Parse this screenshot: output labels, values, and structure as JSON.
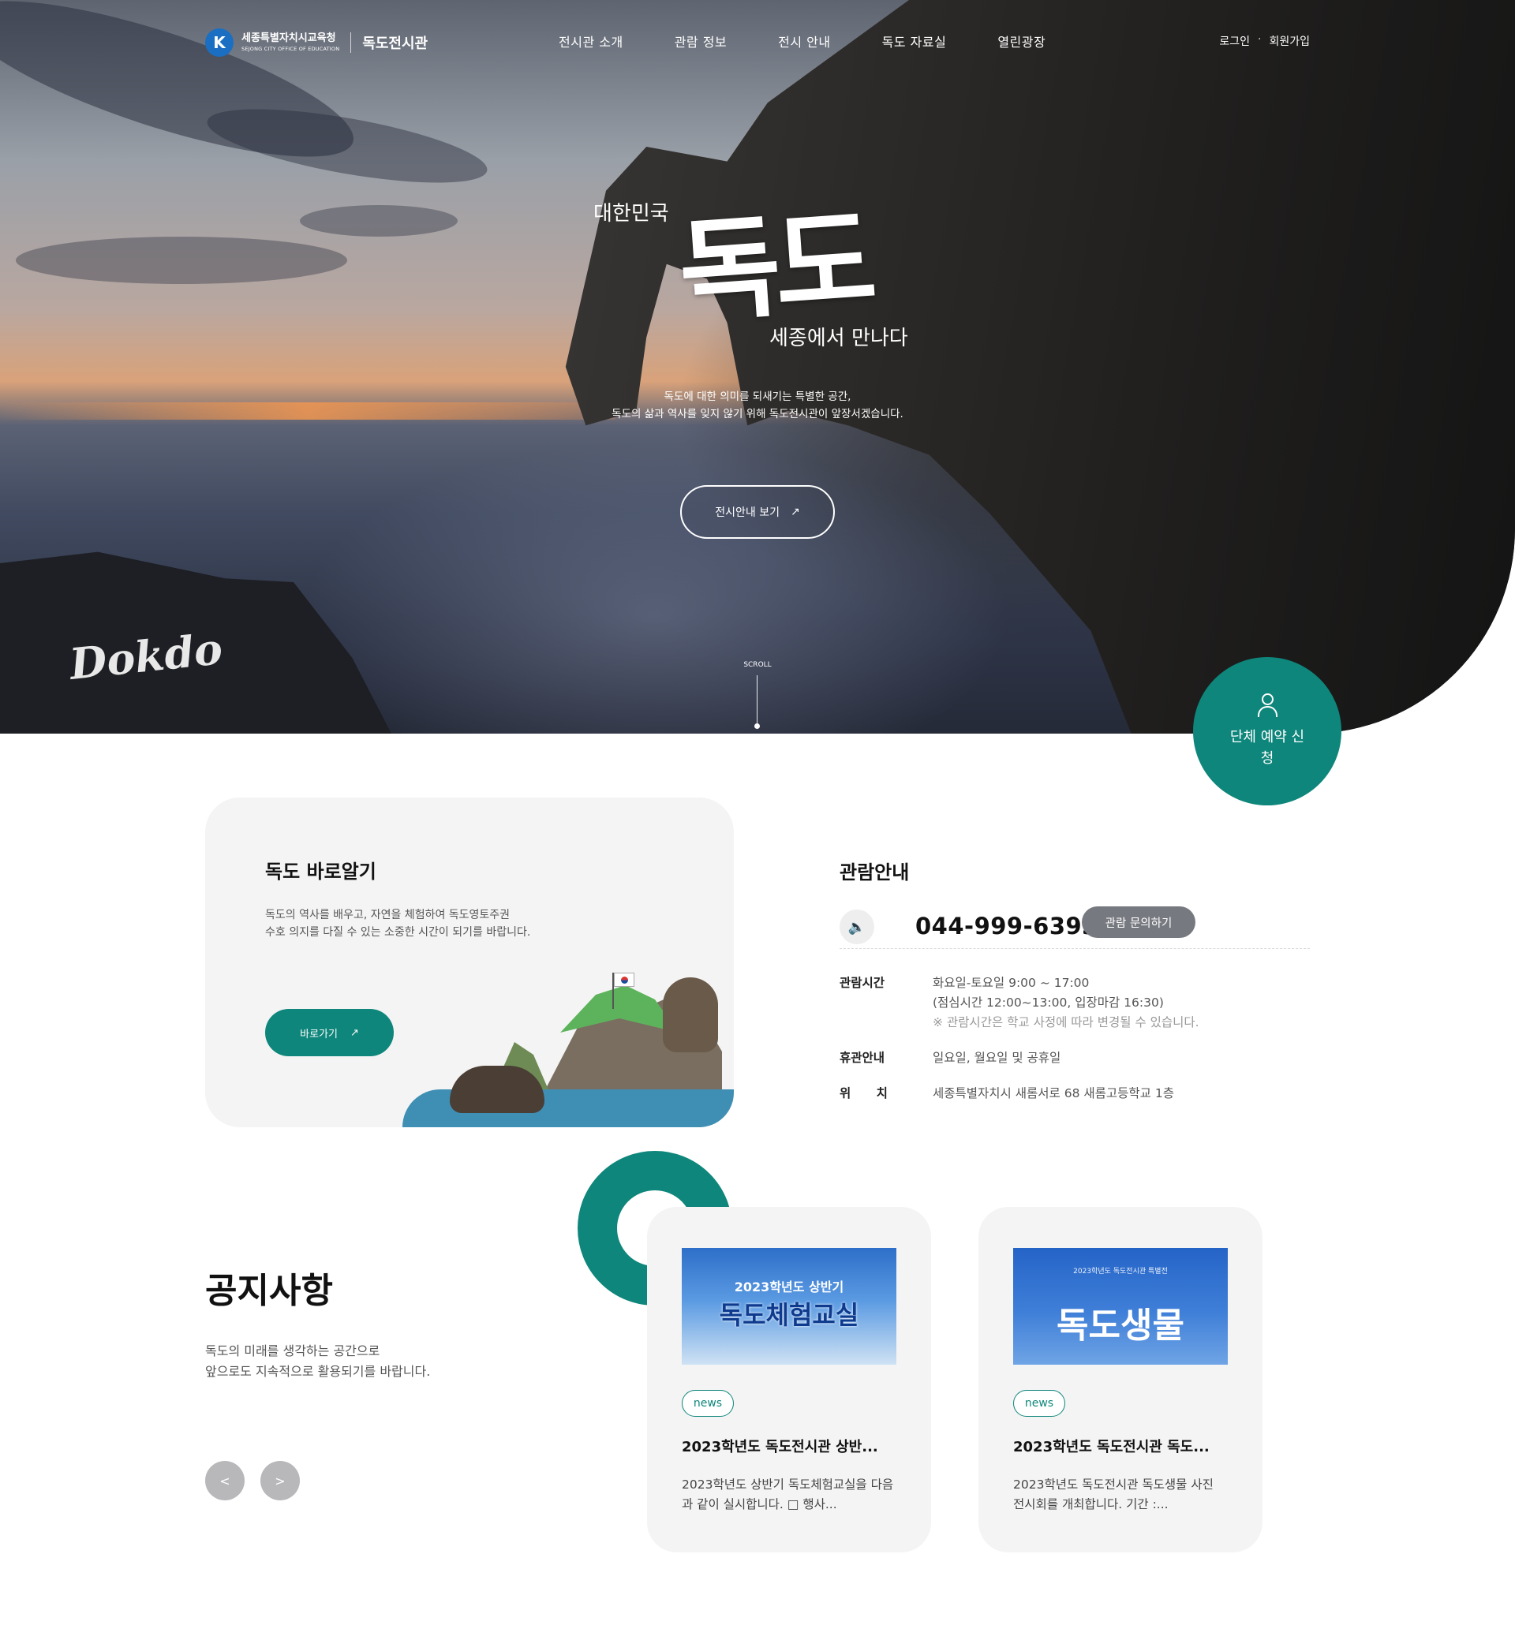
{
  "header": {
    "org_name_ko": "세종특별자치시교육청",
    "org_name_en": "SEJONG CITY OFFICE OF EDUCATION",
    "site_name": "독도전시관",
    "nav": [
      "전시관 소개",
      "관람 정보",
      "전시 안내",
      "독도 자료실",
      "열린광장"
    ],
    "login": "로그인",
    "separator": "·",
    "signup": "회원가입"
  },
  "hero": {
    "kicker": "대한민국",
    "title": "독도",
    "subtitle": "세종에서 만나다",
    "description_line1": "독도에 대한 의미를 되새기는 특별한 공간,",
    "description_line2": "독도의 삶과 역사를 잊지 않기 위해 독도전시관이 앞장서겠습니다.",
    "button_label": "전시안내 보기",
    "scroll_label": "SCROLL",
    "signature": "Dokdo"
  },
  "reserve": {
    "label": "단체 예약 신청",
    "icon": "user-icon"
  },
  "intro": {
    "title": "독도 바로알기",
    "description_line1": "독도의 역사를 배우고, 자연을 체험하여 독도영토주권",
    "description_line2": "수호 의지를 다질 수 있는 소중한 시간이 되기를 바랍니다.",
    "button_label": "바로가기"
  },
  "visit": {
    "title": "관람안내",
    "phone": "044-999-6393",
    "inquiry_label": "관람 문의하기",
    "rows": [
      {
        "key": "관람시간",
        "value": "화요일-토요일 9:00 ~ 17:00",
        "value2": "(점심시간 12:00~13:00, 입장마감 16:30)",
        "note": "※ 관람시간은 학교 사정에 따라 변경될 수 있습니다."
      },
      {
        "key": "휴관안내",
        "value": "일요일, 월요일 및 공휴일"
      },
      {
        "key": "위      치",
        "value": "세종특별자치시 새롬서로 68 새롬고등학교 1층"
      }
    ]
  },
  "notice": {
    "title": "공지사항",
    "description_line1": "독도의 미래를 생각하는 공간으로",
    "description_line2": "앞으로도 지속적으로 활용되기를 바랍니다.",
    "prev": "<",
    "next": ">",
    "cards": [
      {
        "thumb_line1": "2023학년도 상반기",
        "thumb_line2": "독도체험교실",
        "tag": "news",
        "title": "2023학년도 독도전시관 상반...",
        "excerpt": "2023학년도 상반기 독도체험교실을 다음과 같이 실시합니다. □ 행사..."
      },
      {
        "thumb_line1": "2023학년도 독도전시관 특별전",
        "thumb_line2": "독도생물",
        "tag": "news",
        "title": "2023학년도 독도전시관 독도...",
        "excerpt": "2023학년도 독도전시관 독도생물 사진 전시회를 개최합니다. 기간 :..."
      }
    ]
  },
  "colors": {
    "accent": "#0e867b",
    "inquiry_bg": "#777980",
    "arrow_bg": "#b8b8bb",
    "card_bg": "#f4f4f4"
  }
}
